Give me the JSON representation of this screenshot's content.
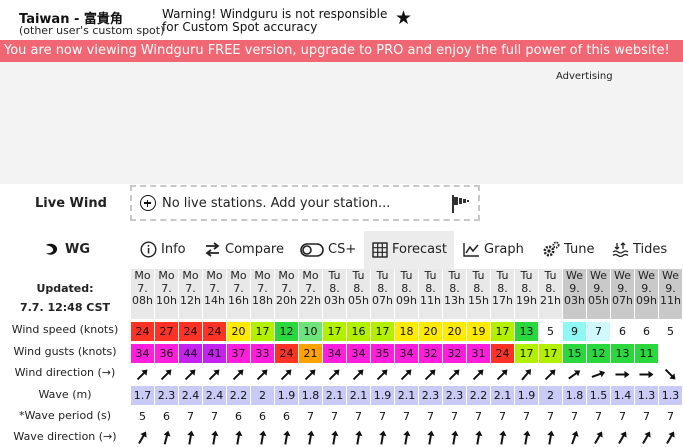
{
  "header": {
    "spot_title": "Taiwan - 富貴角",
    "spot_subtitle": "(other user's custom spot)",
    "warning": "Warning! Windguru is not responsible for Custom Spot accuracy",
    "star_icon": "★"
  },
  "promo_banner": "You are viewing Windguru FREE version, upgrade to PRO and enjoy the full power of this website!",
  "promo_banner_prefix": "You are now viewing Windguru FREE version, upgrade to PRO and enjoy the full power of this website!",
  "advertising_label": "Advertising",
  "live_wind": {
    "label": "Live Wind",
    "text": "No live stations. Add your station..."
  },
  "nav": {
    "wg": "WG",
    "info": "Info",
    "compare": "Compare",
    "cs": "CS+",
    "forecast": "Forecast",
    "graph": "Graph",
    "tune": "Tune",
    "tides": "Tides"
  },
  "updated": {
    "line1": "Updated:",
    "line2": "7.7. 12:48 CST"
  },
  "row_labels": {
    "wind_speed": "Wind speed (knots)",
    "wind_gusts": "Wind gusts (knots)",
    "wind_direction": "Wind direction (→)",
    "wave": "Wave (m)",
    "wave_period": "*Wave period (s)",
    "wave_direction": "Wave direction (→)"
  },
  "forecast": {
    "columns": [
      {
        "day": "Mo",
        "date": "7.",
        "hour": "08h",
        "shade": "light"
      },
      {
        "day": "Mo",
        "date": "7.",
        "hour": "10h",
        "shade": "light"
      },
      {
        "day": "Mo",
        "date": "7.",
        "hour": "12h",
        "shade": "light"
      },
      {
        "day": "Mo",
        "date": "7.",
        "hour": "14h",
        "shade": "light"
      },
      {
        "day": "Mo",
        "date": "7.",
        "hour": "16h",
        "shade": "light"
      },
      {
        "day": "Mo",
        "date": "7.",
        "hour": "18h",
        "shade": "light"
      },
      {
        "day": "Mo",
        "date": "7.",
        "hour": "20h",
        "shade": "light"
      },
      {
        "day": "Mo",
        "date": "7.",
        "hour": "22h",
        "shade": "light"
      },
      {
        "day": "Tu",
        "date": "8.",
        "hour": "03h",
        "shade": "light"
      },
      {
        "day": "Tu",
        "date": "8.",
        "hour": "05h",
        "shade": "light"
      },
      {
        "day": "Tu",
        "date": "8.",
        "hour": "07h",
        "shade": "light"
      },
      {
        "day": "Tu",
        "date": "8.",
        "hour": "09h",
        "shade": "light"
      },
      {
        "day": "Tu",
        "date": "8.",
        "hour": "11h",
        "shade": "light"
      },
      {
        "day": "Tu",
        "date": "8.",
        "hour": "13h",
        "shade": "light"
      },
      {
        "day": "Tu",
        "date": "8.",
        "hour": "15h",
        "shade": "light"
      },
      {
        "day": "Tu",
        "date": "8.",
        "hour": "17h",
        "shade": "light"
      },
      {
        "day": "Tu",
        "date": "8.",
        "hour": "19h",
        "shade": "light"
      },
      {
        "day": "Tu",
        "date": "8.",
        "hour": "21h",
        "shade": "light"
      },
      {
        "day": "We",
        "date": "9.",
        "hour": "03h",
        "shade": "dark"
      },
      {
        "day": "We",
        "date": "9.",
        "hour": "05h",
        "shade": "dark"
      },
      {
        "day": "We",
        "date": "9.",
        "hour": "07h",
        "shade": "dark"
      },
      {
        "day": "We",
        "date": "9.",
        "hour": "09h",
        "shade": "dark"
      },
      {
        "day": "We",
        "date": "9.",
        "hour": "11h",
        "shade": "dark"
      }
    ],
    "wind_speed": [
      "24",
      "27",
      "24",
      "24",
      "20",
      "17",
      "12",
      "10",
      "17",
      "16",
      "17",
      "18",
      "20",
      "20",
      "19",
      "17",
      "13",
      "5",
      "9",
      "7",
      "6",
      "6",
      "5"
    ],
    "wind_speed_colors": [
      "#ff3226",
      "#ff3226",
      "#ff3226",
      "#ff3226",
      "#ffea00",
      "#b2f000",
      "#2ad73c",
      "#6ee37c",
      "#b2f000",
      "#b2f000",
      "#b2f000",
      "#ffea00",
      "#ffea00",
      "#ffea00",
      "#ffea00",
      "#b2f000",
      "#2ad73c",
      "#ffffff",
      "#8ff7f4",
      "#cff8ff",
      "#ffffff",
      "#ffffff",
      "#ffffff"
    ],
    "wind_gusts": [
      "34",
      "36",
      "44",
      "41",
      "37",
      "33",
      "24",
      "21",
      "34",
      "34",
      "35",
      "34",
      "32",
      "32",
      "31",
      "24",
      "17",
      "17",
      "15",
      "12",
      "13",
      "11"
    ],
    "wind_gusts_colors": [
      "#ff1edb",
      "#ff1edb",
      "#c522f0",
      "#c522f0",
      "#ff1edb",
      "#ff1edb",
      "#ff3226",
      "#ffa200",
      "#ff1edb",
      "#ff1edb",
      "#ff1edb",
      "#ff1edb",
      "#ff1edb",
      "#ff1edb",
      "#ff1edb",
      "#ff3226",
      "#b2f000",
      "#b2f000",
      "#2ad73c",
      "#2ad73c",
      "#2ad73c",
      "#2ad73c"
    ],
    "wind_direction_deg": [
      45,
      45,
      45,
      45,
      45,
      45,
      45,
      45,
      45,
      45,
      45,
      45,
      45,
      45,
      45,
      45,
      50,
      45,
      35,
      20,
      0,
      0,
      -45
    ],
    "wave": [
      "1.7",
      "2.3",
      "2.4",
      "2.4",
      "2.2",
      "2",
      "1.9",
      "1.8",
      "2.1",
      "2.1",
      "1.9",
      "2.1",
      "2.3",
      "2.3",
      "2.2",
      "2.1",
      "1.9",
      "2",
      "1.8",
      "1.5",
      "1.4",
      "1.3",
      "1.3"
    ],
    "wave_period": [
      "5",
      "6",
      "7",
      "7",
      "6",
      "6",
      "6",
      "7",
      "7",
      "7",
      "7",
      "7",
      "7",
      "7",
      "7",
      "7",
      "7",
      "7",
      "7",
      "7",
      "7",
      "7",
      "7"
    ],
    "wave_direction_deg": [
      60,
      75,
      80,
      80,
      80,
      80,
      80,
      80,
      80,
      80,
      80,
      80,
      80,
      80,
      80,
      80,
      80,
      80,
      70,
      60,
      60,
      60,
      60
    ]
  },
  "colors": {
    "promo": "#f06672",
    "active_tab": "#ececec"
  }
}
